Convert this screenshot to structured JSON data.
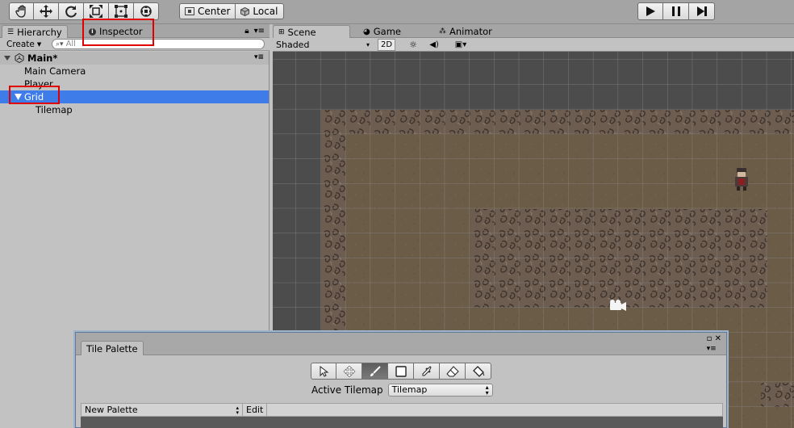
{
  "toolbar": {
    "transform_tools": [
      "hand-tool-icon",
      "move-tool-icon",
      "rotate-tool-icon",
      "scale-tool-icon",
      "rect-tool-icon",
      "transform-tool-icon"
    ],
    "pivot_label": "Center",
    "space_label": "Local",
    "play_controls": [
      "play-icon",
      "pause-icon",
      "step-icon"
    ]
  },
  "hierarchy": {
    "tab_label": "Hierarchy",
    "inspector_tab_label": "Inspector",
    "create_label": "Create",
    "search_placeholder": "All",
    "scene_name": "Main*",
    "items": [
      {
        "label": "Main Camera",
        "depth": 1
      },
      {
        "label": "Player",
        "depth": 1
      },
      {
        "label": "Grid",
        "depth": 1,
        "selected": true,
        "expanded": true
      },
      {
        "label": "Tilemap",
        "depth": 2
      }
    ]
  },
  "scene_view": {
    "tabs": [
      "Scene",
      "Game",
      "Animator"
    ],
    "shading_mode": "Shaded",
    "mode_2d_label": "2D"
  },
  "tile_palette": {
    "title": "Tile Palette",
    "tools": [
      "select-icon",
      "move-icon",
      "paint-brush-icon",
      "box-fill-icon",
      "picker-icon",
      "eraser-icon",
      "flood-fill-icon"
    ],
    "active_tool": "paint-brush-icon",
    "active_tilemap_label": "Active Tilemap",
    "active_tilemap_value": "Tilemap",
    "palette_select_value": "New Palette",
    "edit_label": "Edit"
  },
  "colors": {
    "selection": "#3e7de9",
    "highlight_box": "#e00000",
    "window_bg": "#c2c2c2"
  }
}
